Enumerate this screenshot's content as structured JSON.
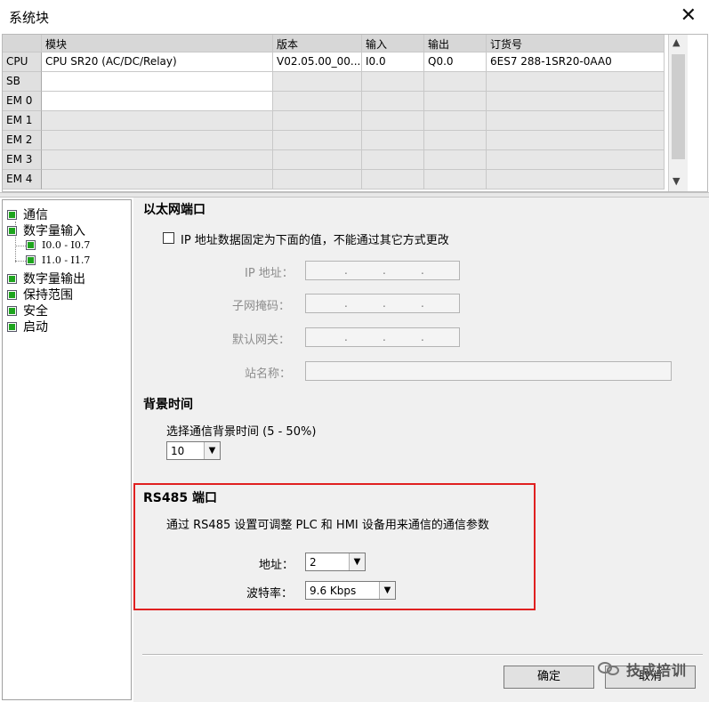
{
  "window": {
    "title": "系统块",
    "close_glyph": "✕"
  },
  "table": {
    "columns": [
      "",
      "模块",
      "版本",
      "输入",
      "输出",
      "订货号"
    ],
    "rows": [
      {
        "slot": "CPU",
        "module": "CPU SR20 (AC/DC/Relay)",
        "version": "V02.05.00_00....",
        "input": "I0.0",
        "output": "Q0.0",
        "order": "6ES7 288-1SR20-0AA0"
      },
      {
        "slot": "SB",
        "module": "",
        "version": "",
        "input": "",
        "output": "",
        "order": ""
      },
      {
        "slot": "EM 0",
        "module": "",
        "version": "",
        "input": "",
        "output": "",
        "order": ""
      },
      {
        "slot": "EM 1",
        "module": "",
        "version": "",
        "input": "",
        "output": "",
        "order": ""
      },
      {
        "slot": "EM 2",
        "module": "",
        "version": "",
        "input": "",
        "output": "",
        "order": ""
      },
      {
        "slot": "EM 3",
        "module": "",
        "version": "",
        "input": "",
        "output": "",
        "order": ""
      },
      {
        "slot": "EM 4",
        "module": "",
        "version": "",
        "input": "",
        "output": "",
        "order": ""
      }
    ]
  },
  "tree": {
    "items": [
      {
        "label": "通信"
      },
      {
        "label": "数字量输入"
      },
      {
        "label": "I0.0 - I0.7"
      },
      {
        "label": "I1.0 - I1.7"
      },
      {
        "label": "数字量输出"
      },
      {
        "label": "保持范围"
      },
      {
        "label": "安全"
      },
      {
        "label": "启动"
      }
    ]
  },
  "ethernet": {
    "heading": "以太网端口",
    "fixed_ip_label": "IP 地址数据固定为下面的值，不能通过其它方式更改",
    "ip_label": "IP 地址：",
    "mask_label": "子网掩码：",
    "gateway_label": "默认网关：",
    "station_label": "站名称：",
    "ip_dots": "."
  },
  "background": {
    "heading": "背景时间",
    "label": "选择通信背景时间 (5 - 50%)",
    "value": "10"
  },
  "rs485": {
    "heading": "RS485 端口",
    "description": "通过 RS485 设置可调整 PLC 和 HMI 设备用来通信的通信参数",
    "address_label": "地址：",
    "address_value": "2",
    "baud_label": "波特率：",
    "baud_value": "9.6 Kbps"
  },
  "buttons": {
    "ok": "确定",
    "cancel": "取消"
  },
  "watermark": {
    "text": "技成培训"
  },
  "colors": {
    "highlight_box": "#e02020",
    "tree_icon": "#1ea51e"
  }
}
